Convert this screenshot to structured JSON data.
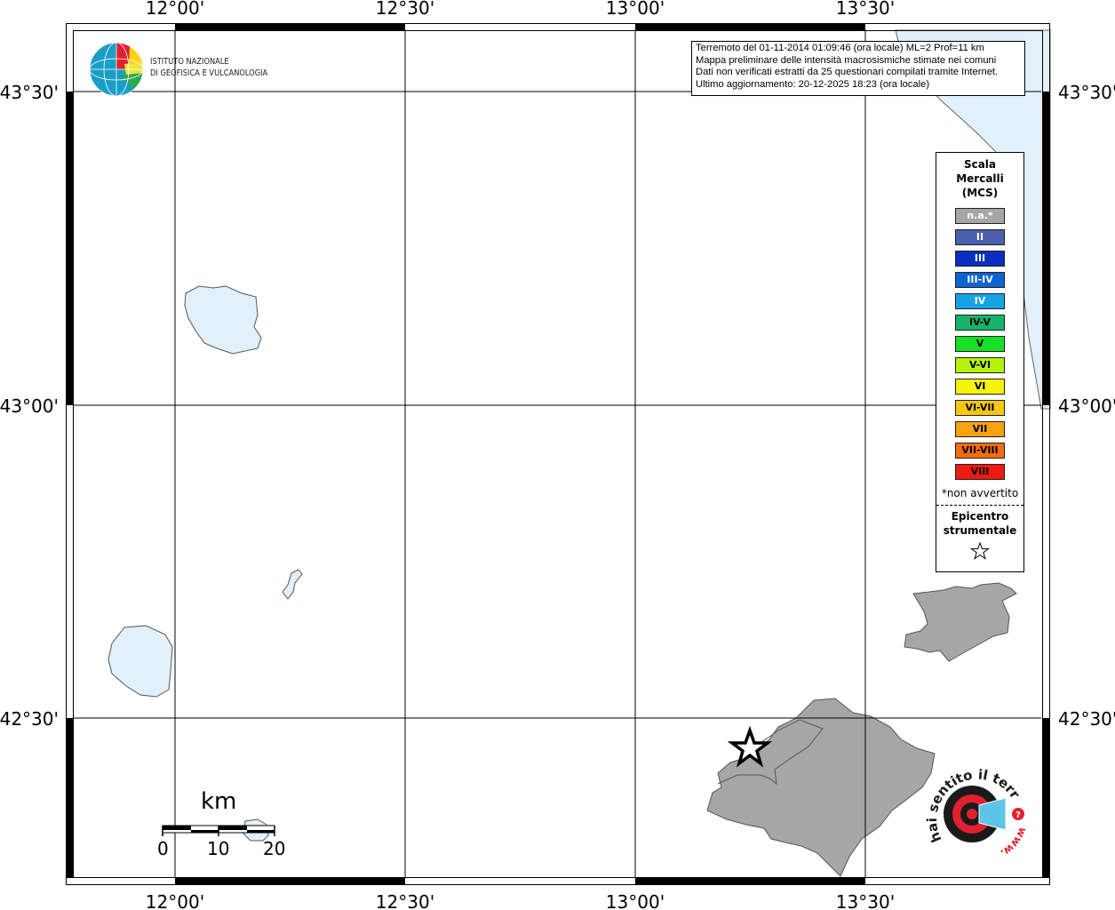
{
  "map": {
    "longitude_ticks": [
      "12°00'",
      "12°30'",
      "13°00'",
      "13°30'"
    ],
    "latitude_ticks": [
      "43°30'",
      "43°00'",
      "42°30'"
    ]
  },
  "logo": {
    "line1": "ISTITUTO NAZIONALE",
    "line2": "DI GEOFISICA E VULCANOLOGIA"
  },
  "info": {
    "line1": "Terremoto del 01-11-2014 01:09:46 (ora locale) ML=2 Prof=11 km",
    "line2": "Mappa preliminare delle intensità macrosismiche stimate nei comuni",
    "line3": "Dati non verificati estratti da 25 questionari compilati tramite Internet.",
    "line4": "Ultimo aggiornamento: 20-12-2025 18:23 (ora locale)"
  },
  "legend": {
    "title_line1": "Scala",
    "title_line2": "Mercalli",
    "title_line3": "(MCS)",
    "items": [
      {
        "label": "n.a.*",
        "color": "#a6a6a6",
        "text_color": "#ffffff"
      },
      {
        "label": "II",
        "color": "#4a5fae",
        "text_color": "#ffffff"
      },
      {
        "label": "III",
        "color": "#0a2fbf",
        "text_color": "#ffffff"
      },
      {
        "label": "III-IV",
        "color": "#0d63d0",
        "text_color": "#ffffff"
      },
      {
        "label": "IV",
        "color": "#15a3e6",
        "text_color": "#ffffff"
      },
      {
        "label": "IV-V",
        "color": "#14b56b",
        "text_color": "#000000"
      },
      {
        "label": "V",
        "color": "#16e024",
        "text_color": "#000000"
      },
      {
        "label": "V-VI",
        "color": "#b4f20c",
        "text_color": "#000000"
      },
      {
        "label": "VI",
        "color": "#f7f20e",
        "text_color": "#000000"
      },
      {
        "label": "VI-VII",
        "color": "#f7c70e",
        "text_color": "#000000"
      },
      {
        "label": "VII",
        "color": "#f8a20f",
        "text_color": "#000000"
      },
      {
        "label": "VII-VIII",
        "color": "#f56c10",
        "text_color": "#000000"
      },
      {
        "label": "VIII",
        "color": "#ef1a12",
        "text_color": "#000000"
      }
    ],
    "note": "*non avvertito",
    "epicenter_line1": "Epicentro",
    "epicenter_line2": "strumentale",
    "star": "☆"
  },
  "scalebar": {
    "unit": "km",
    "ticks": [
      "0",
      "10",
      "20"
    ]
  },
  "badge": {
    "text": "hai sentito il terremoto.it",
    "prefix": "www."
  },
  "colors": {
    "water": "#e1f0fb",
    "felt_area": "#a6a6a6",
    "outline": "#555555"
  }
}
